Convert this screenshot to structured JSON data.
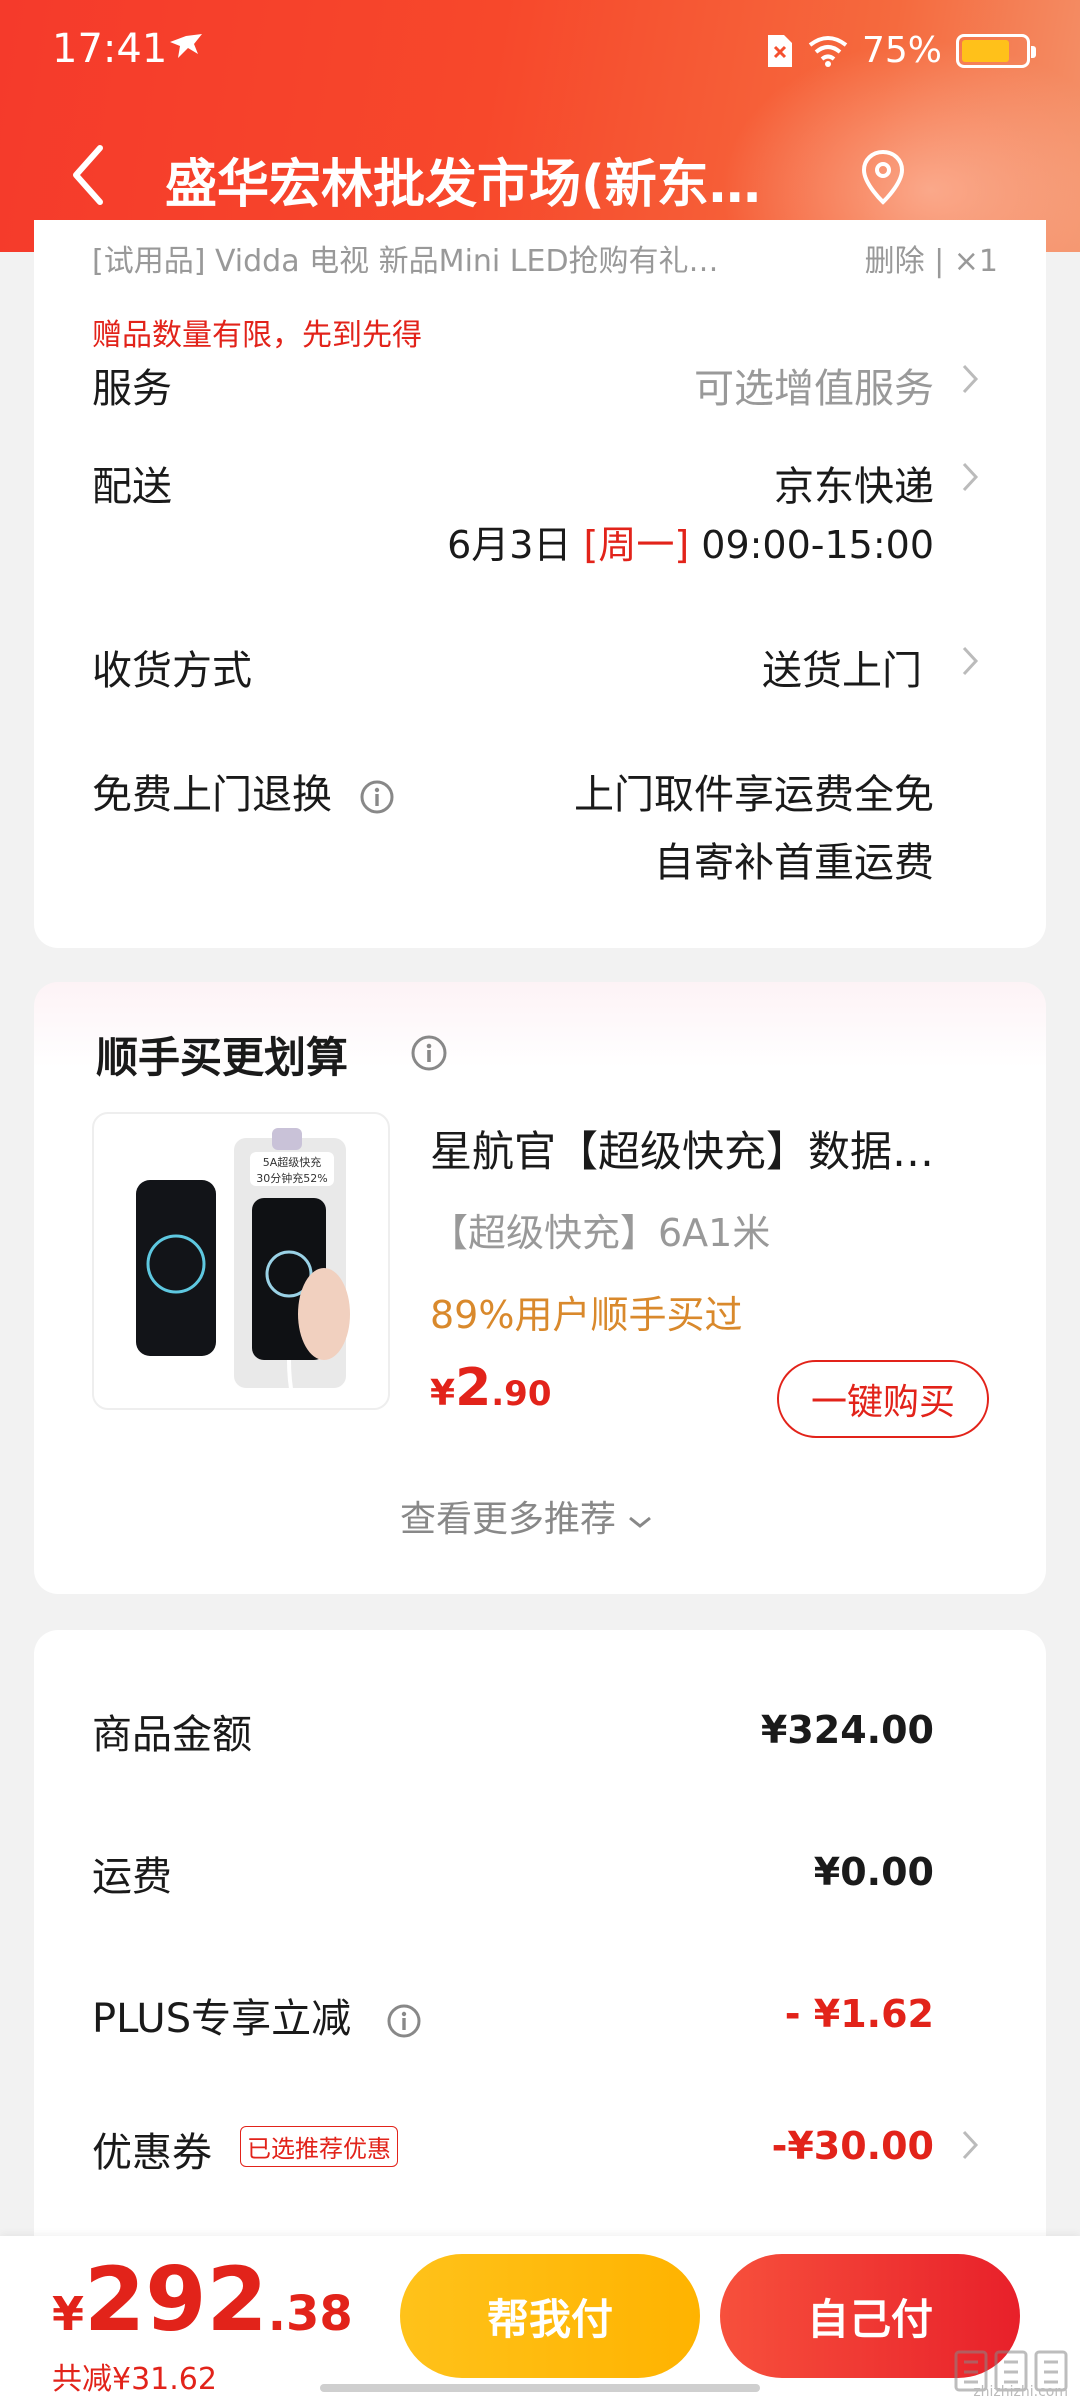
{
  "status_bar": {
    "time": "17:41",
    "battery": "75%",
    "battery_level": 0.75
  },
  "header": {
    "title": "盛华宏林批发市场(新东…"
  },
  "item_row": {
    "name": "[试用品]  Vidda 电视 新品Mini LED抢购有礼…",
    "actions": "删除 | ×1",
    "gift_note": "赠品数量有限，先到先得"
  },
  "service": {
    "label": "服务",
    "value": "可选增值服务"
  },
  "delivery": {
    "label": "配送",
    "value": "京东快递",
    "date": "6月3日",
    "weekday": "[周一]",
    "time_window": "09:00-15:00"
  },
  "receive": {
    "label": "收货方式",
    "value": "送货上门"
  },
  "return": {
    "label": "免费上门退换",
    "line1": "上门取件享运费全免",
    "line2": "自寄补首重运费"
  },
  "recommend": {
    "title": "顺手买更划算",
    "product": {
      "title": "星航官【超级快充】数据…",
      "spec": "【超级快充】6A1米",
      "buyers": "89%用户顺手买过",
      "price_symbol": "¥",
      "price_int": "2",
      "price_dec": ".90",
      "buy_label": "一键购买",
      "img_badge_line1": "5A超级快充",
      "img_badge_line2": "30分钟充52%"
    },
    "more_label": "查看更多推荐"
  },
  "summary": {
    "goods": {
      "label": "商品金额",
      "value": "¥324.00"
    },
    "shipping": {
      "label": "运费",
      "value": "¥0.00"
    },
    "plus": {
      "label": "PLUS专享立减",
      "value": "- ¥1.62"
    },
    "coupon": {
      "label": "优惠券",
      "tag": "已选推荐优惠",
      "value": "-¥30.00"
    }
  },
  "bottom": {
    "price_symbol": "¥",
    "price_int": "292",
    "price_dec": ".38",
    "saved": "共减¥31.62",
    "help_pay": "帮我付",
    "self_pay": "自己付"
  },
  "watermark": {
    "text": "zhizhizhi.com"
  }
}
